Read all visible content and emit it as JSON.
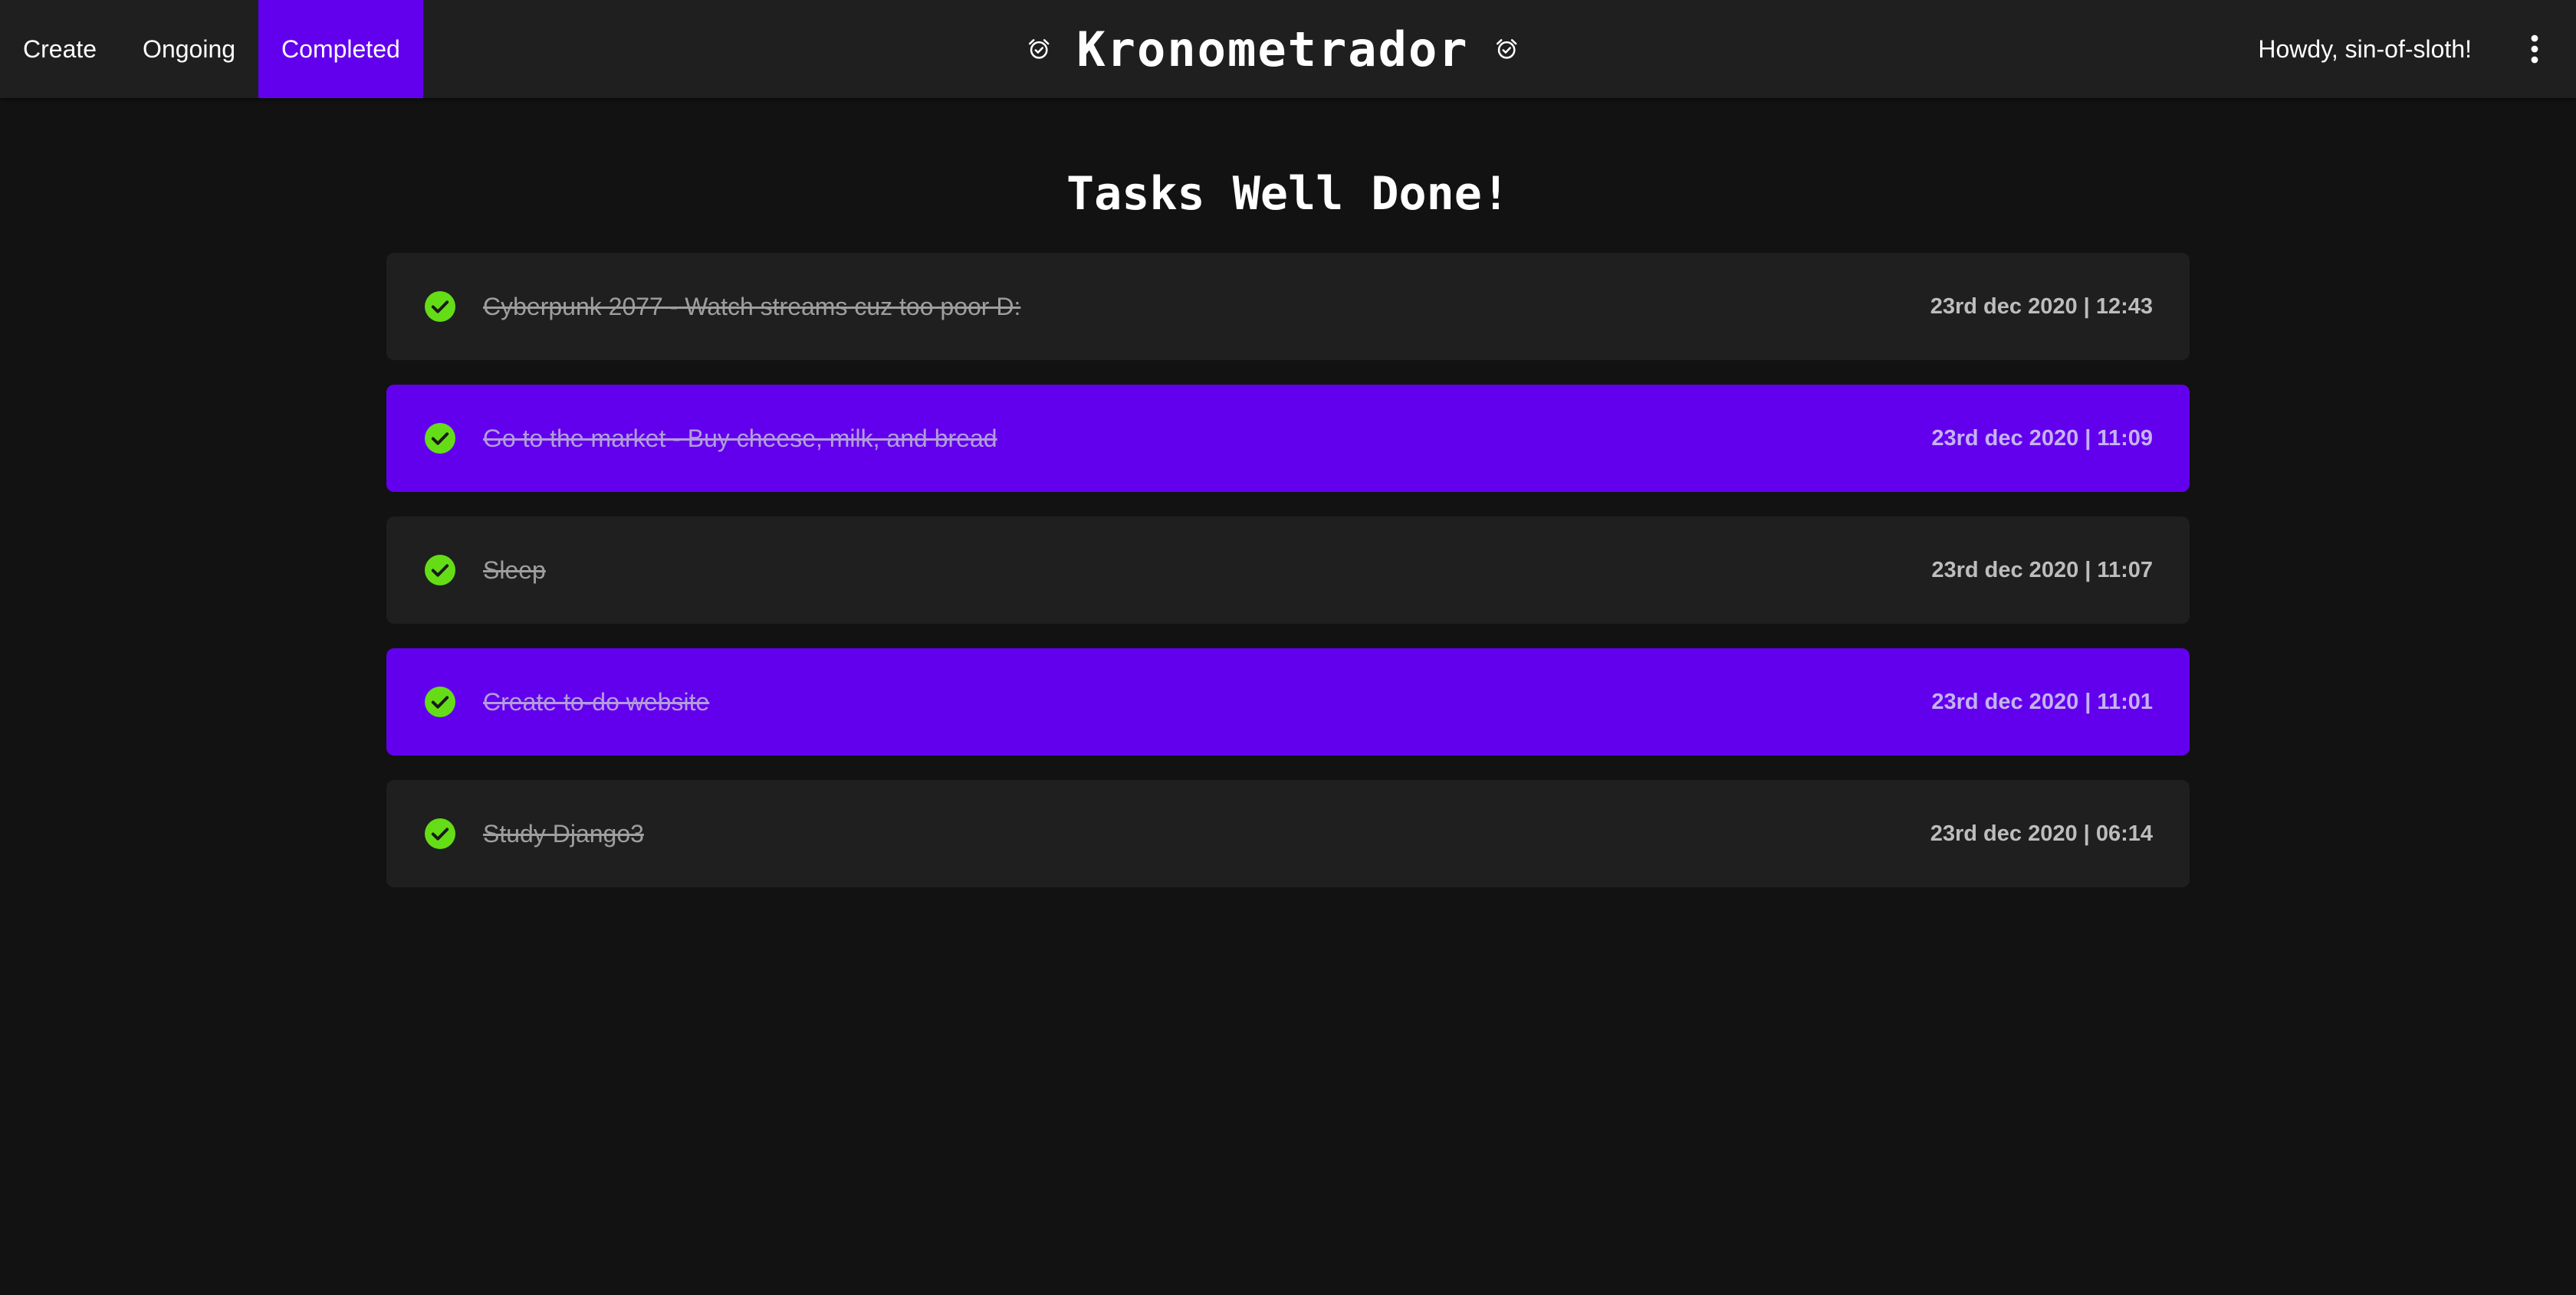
{
  "nav": {
    "links": [
      {
        "label": "Create",
        "active": false
      },
      {
        "label": "Ongoing",
        "active": false
      },
      {
        "label": "Completed",
        "active": true
      }
    ],
    "brand": "Kronometrador",
    "brand_icon": "alarm-clock-check-icon",
    "greeting": "Howdy, sin-of-sloth!",
    "menu_icon": "more-vertical-icon"
  },
  "page": {
    "title": "Tasks Well Done!"
  },
  "tasks": [
    {
      "title": "Cyberpunk 2077 - Watch streams cuz too poor D:",
      "date": "23rd dec 2020 | 12:43",
      "style": "dark"
    },
    {
      "title": "Go to the market - Buy cheese, milk, and bread",
      "date": "23rd dec 2020 | 11:09",
      "style": "purple"
    },
    {
      "title": "Sleep",
      "date": "23rd dec 2020 | 11:07",
      "style": "dark"
    },
    {
      "title": "Create to-do website",
      "date": "23rd dec 2020 | 11:01",
      "style": "purple"
    },
    {
      "title": "Study Django3",
      "date": "23rd dec 2020 | 06:14",
      "style": "dark"
    }
  ],
  "colors": {
    "accent": "#6200ee",
    "check": "#64dd17",
    "background": "#121212",
    "surface": "#1f1f1f"
  }
}
